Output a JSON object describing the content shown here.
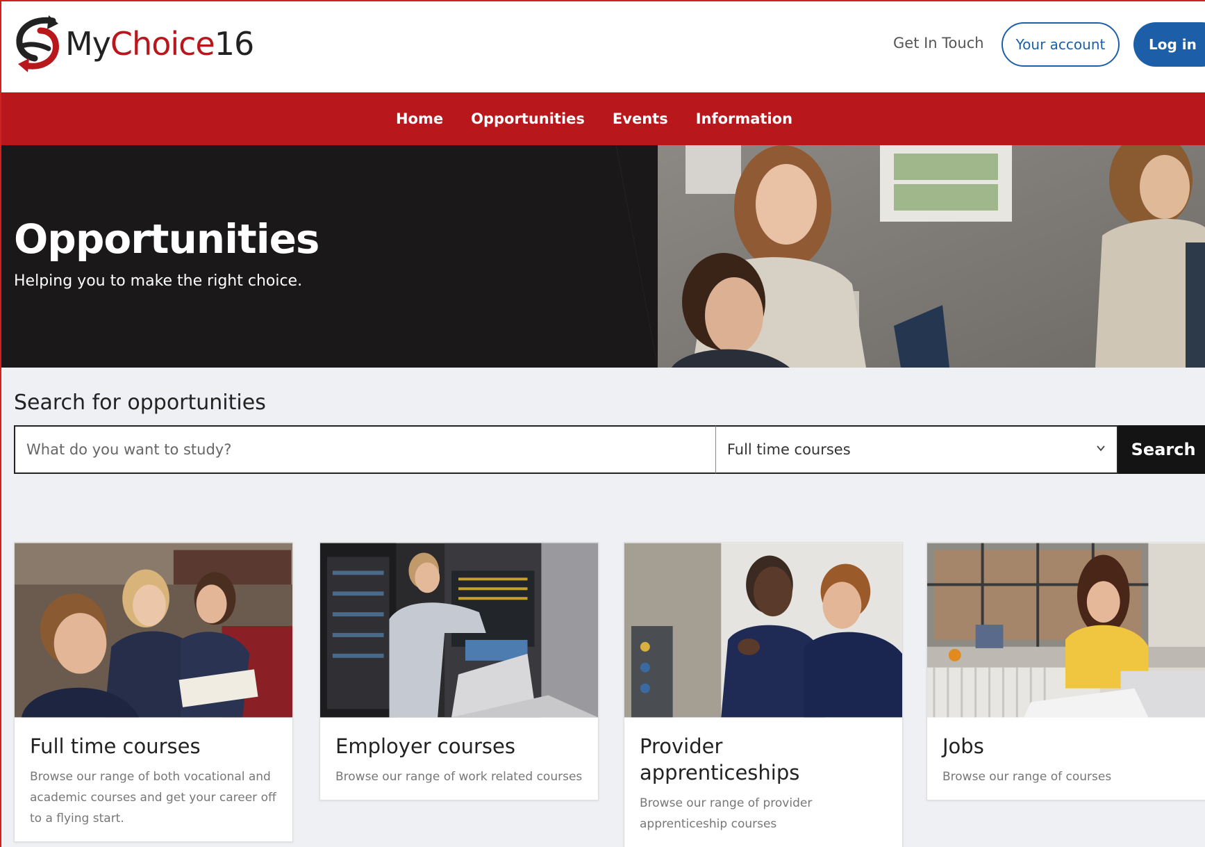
{
  "brand": {
    "my": "My",
    "choice": "Choice",
    "num": "16"
  },
  "header": {
    "get_in_touch": "Get In Touch",
    "your_account": "Your account",
    "log_in": "Log in"
  },
  "nav": {
    "items": [
      {
        "label": "Home"
      },
      {
        "label": "Opportunities"
      },
      {
        "label": "Events"
      },
      {
        "label": "Information"
      }
    ]
  },
  "hero": {
    "title": "Opportunities",
    "subtitle": "Helping you to make the right choice."
  },
  "search": {
    "label": "Search for opportunities",
    "placeholder": "What do you want to study?",
    "selected": "Full time courses",
    "button": "Search"
  },
  "cards": [
    {
      "title": "Full time courses",
      "desc": "Browse our range of both vocational and academic courses and get your career off to a flying start."
    },
    {
      "title": "Employer courses",
      "desc": "Browse our range of work related courses"
    },
    {
      "title": "Provider apprenticeships",
      "desc": "Browse our range of provider apprenticeship courses"
    },
    {
      "title": "Jobs",
      "desc": "Browse our range of courses"
    }
  ],
  "colors": {
    "brand_red": "#b8171b",
    "brand_blue": "#1c5fa8",
    "dark": "#1a1819"
  }
}
